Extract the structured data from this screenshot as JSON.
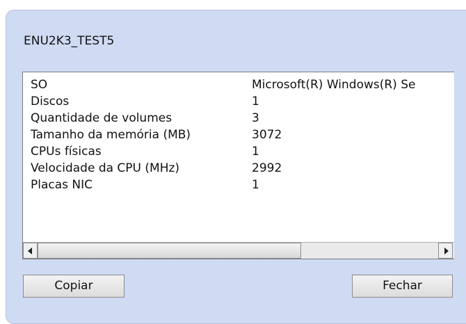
{
  "dialog": {
    "title": "ENU2K3_TEST5"
  },
  "details": {
    "rows": [
      {
        "label": "SO",
        "value": "Microsoft(R) Windows(R) Se"
      },
      {
        "label": "Discos",
        "value": "1"
      },
      {
        "label": "Quantidade de volumes",
        "value": "3"
      },
      {
        "label": "Tamanho da memória (MB)",
        "value": "3072"
      },
      {
        "label": "CPUs físicas",
        "value": "1"
      },
      {
        "label": "Velocidade da CPU (MHz)",
        "value": "2992"
      },
      {
        "label": "Placas NIC",
        "value": "1"
      }
    ]
  },
  "buttons": {
    "copy_label": "Copiar",
    "close_label": "Fechar"
  },
  "icons": {
    "scroll_left": "arrow-left-icon",
    "scroll_right": "arrow-right-icon"
  }
}
